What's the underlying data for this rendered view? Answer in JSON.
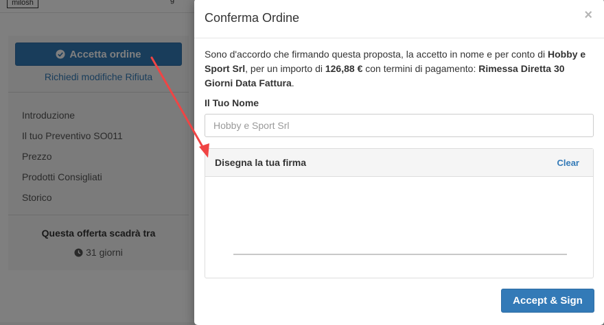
{
  "background_page": {
    "logo_text": "milosh",
    "nav_fragment": "g",
    "accept_button_label": "Accetta ordine",
    "request_changes_link": "Richiedi modifiche",
    "reject_link": "Rifiuta",
    "nav_items": [
      "Introduzione",
      "Il tuo Preventivo SO011",
      "Prezzo",
      "Prodotti Consigliati",
      "Storico"
    ],
    "expiry_title": "Questa offerta scadrà tra",
    "expiry_days": "31 giorni"
  },
  "modal": {
    "title": "Conferma Ordine",
    "close_glyph": "×",
    "terms": {
      "p1": "Sono d'accordo che firmando questa proposta, la accetto in nome e per conto di ",
      "company": "Hobby e Sport Srl",
      "p2": ", per un importo di ",
      "amount": "126,88 €",
      "p3": " con termini di pagamento: ",
      "payment_terms": "Rimessa Diretta 30 Giorni Data Fattura",
      "p4": "."
    },
    "name_label": "Il Tuo Nome",
    "name_placeholder": "Hobby e Sport Srl",
    "signature_title": "Disegna la tua firma",
    "clear_label": "Clear",
    "submit_label": "Accept & Sign"
  },
  "colors": {
    "primary": "#337ab7",
    "overlay": "rgba(0,0,0,0.5)",
    "annotation_arrow": "#f04444"
  },
  "icons": {
    "accept": "check-circle-icon",
    "expiry": "clock-icon",
    "close": "close-icon",
    "annotation": "red-arrow-annotation"
  }
}
